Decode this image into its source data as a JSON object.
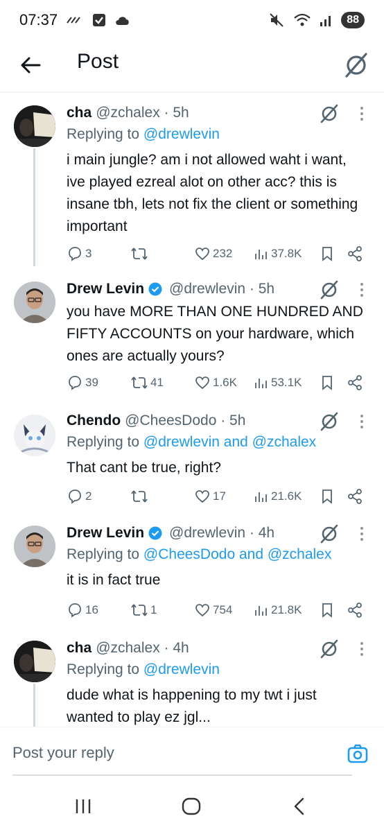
{
  "status": {
    "time": "07:37",
    "battery": "88"
  },
  "header": {
    "title": "Post"
  },
  "tweets": [
    {
      "name": "cha",
      "handle": "@zchalex · 5h",
      "replying_prefix": "Replying to ",
      "replying_to": "@drewlevin",
      "text": "i main jungle? am i not allowed waht i want, ive played ezreal alot on other acc? this is insane tbh, lets not fix the client or something important",
      "replies": "3",
      "reposts": "",
      "likes": "232",
      "views": "37.8K"
    },
    {
      "name": "Drew Levin",
      "handle": "@drewlevin · 5h",
      "text": "you have MORE THAN ONE HUNDRED AND FIFTY ACCOUNTS on your hardware, which ones are actually yours?",
      "replies": "39",
      "reposts": "41",
      "likes": "1.6K",
      "views": "53.1K"
    },
    {
      "name": "Chendo",
      "handle": "@CheesDodo · 5h",
      "replying_prefix": "Replying to ",
      "replying_to": "@drewlevin and @zchalex",
      "text": "That cant be true, right?",
      "replies": "2",
      "reposts": "",
      "likes": "17",
      "views": "21.6K"
    },
    {
      "name": "Drew Levin",
      "handle": "@drewlevin · 4h",
      "replying_prefix": "Replying to ",
      "replying_to": "@CheesDodo and @zchalex",
      "text": "it is in fact true",
      "replies": "16",
      "reposts": "1",
      "likes": "754",
      "views": "21.8K"
    },
    {
      "name": "cha",
      "handle": "@zchalex · 4h",
      "replying_prefix": "Replying to ",
      "replying_to": "@drewlevin",
      "text": "dude what is happening to my twt i just wanted to play ez jgl..."
    }
  ],
  "reply_bar": {
    "placeholder": "Post your reply"
  },
  "colors": {
    "accent": "#1d9bf0",
    "secondary_text": "#536471",
    "thread_line": "#cfd9de"
  },
  "icons": [
    "back-arrow-icon",
    "grok-icon",
    "more-icon",
    "reply-icon",
    "repost-icon",
    "like-icon",
    "views-icon",
    "bookmark-icon",
    "share-icon",
    "camera-icon",
    "verified-icon"
  ]
}
